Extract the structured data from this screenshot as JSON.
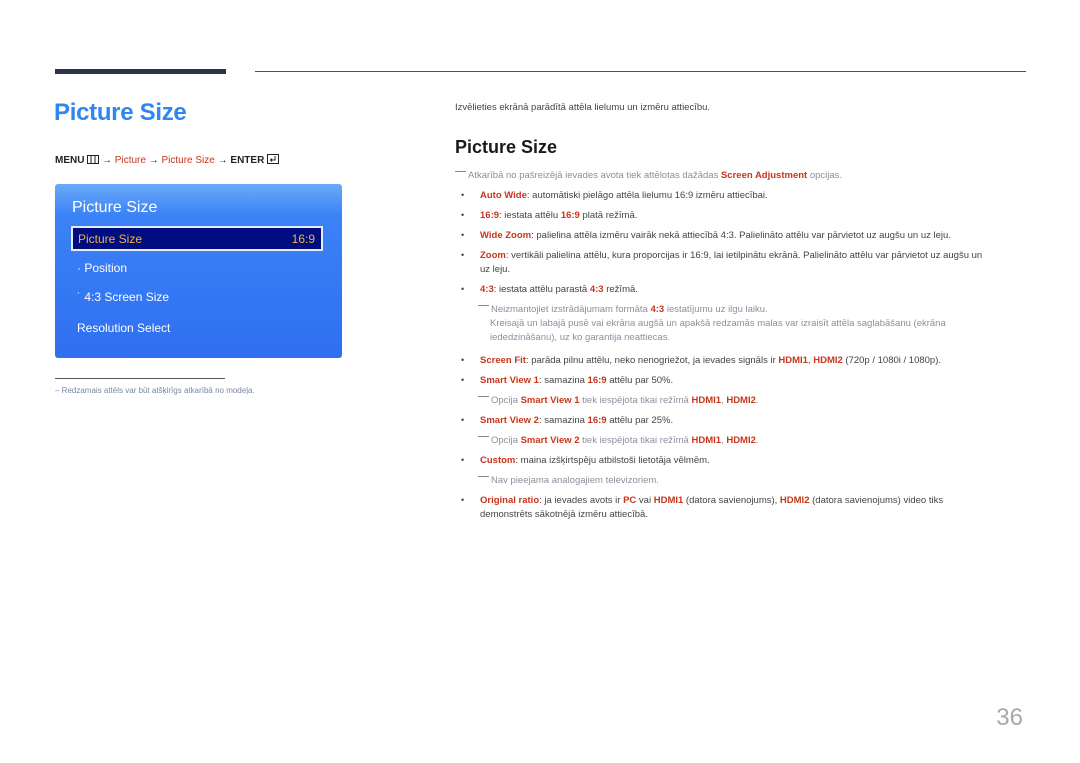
{
  "page": {
    "title": "Picture Size",
    "page_number": "36"
  },
  "menu_path": {
    "menu": "MENU",
    "sep": "→",
    "picture": "Picture",
    "picture_size": "Picture Size",
    "enter": "ENTER"
  },
  "osd": {
    "title": "Picture Size",
    "selected_label": "Picture Size",
    "selected_value": "16:9",
    "items": [
      {
        "label": "· Position"
      },
      {
        "label": "˙ 4:3 Screen Size"
      },
      {
        "label": "Resolution Select"
      }
    ]
  },
  "footnote": "Redzamais attēls var būt atšķirīgs atkarībā no modeļa.",
  "content": {
    "intro": "Izvēlieties ekrānā parādītā attēla lielumu un izmēru attiecību.",
    "section_title": "Picture Size",
    "note_top": {
      "pre": "Atkarībā no pašreizējā ievades avota tiek attēlotas dažādas ",
      "hl": "Screen Adjustment",
      "post": " opcijas."
    },
    "auto_wide": {
      "term": "Auto Wide",
      "text": ": automātiski pielāgo attēla lielumu 16:9 izmēru attiecībai."
    },
    "r169": {
      "term": "16:9",
      "text1": ": iestata attēlu ",
      "hl": "16:9",
      "text2": " platā režīmā."
    },
    "wide_zoom": {
      "term": "Wide Zoom",
      "text": ": palielina attēla izmēru vairāk nekā attiecībā 4:3. Palielināto attēlu var pārvietot uz augšu un uz leju."
    },
    "zoom": {
      "term": "Zoom",
      "text": ": vertikāli palielina attēlu, kura proporcijas ir 16:9, lai ietilpinātu ekrānā. Palielināto attēlu var pārvietot uz augšu un",
      "text_cont": "uz leju."
    },
    "r43": {
      "term": "4:3",
      "text1": ": iestata attēlu parastā ",
      "hl": "4:3",
      "text2": " režīmā."
    },
    "r43_note": {
      "pre": "Neizmantojiet izstrādājumam formāta ",
      "hl": "4:3",
      "post": " iestatījumu uz ilgu laiku.",
      "line2": "Kreisajā un labajā pusē vai ekrāna augšā un apakšā redzamās malas var izraisīt attēla saglabāšanu (ekrāna",
      "line3": "iededzināšanu), uz ko garantija neattiecas."
    },
    "screen_fit": {
      "term": "Screen Fit",
      "text1": ": parāda pilnu attēlu, neko nenogriežot, ja ievades signāls ir ",
      "hl1": "HDMI1",
      "sep": ", ",
      "hl2": "HDMI2",
      "text2": " (720p / 1080i / 1080p)."
    },
    "sv1": {
      "term": "Smart View 1",
      "text1": ": samazina ",
      "hl": "16:9",
      "text2": " attēlu par 50%."
    },
    "sv1_note": {
      "pre": "Opcija ",
      "hl": "Smart View 1",
      "mid": " tiek iespējota tikai režīmā ",
      "hl1": "HDMI1",
      "sep": ", ",
      "hl2": "HDMI2",
      "post": "."
    },
    "sv2": {
      "term": "Smart View 2",
      "text1": ": samazina ",
      "hl": "16:9",
      "text2": " attēlu par 25%."
    },
    "sv2_note": {
      "pre": "Opcija ",
      "hl": "Smart View 2",
      "mid": " tiek iespējota tikai režīmā ",
      "hl1": "HDMI1",
      "sep": ", ",
      "hl2": "HDMI2",
      "post": "."
    },
    "custom": {
      "term": "Custom",
      "text": ": maina izšķirtspēju atbilstoši lietotāja vēlmēm."
    },
    "custom_note": "Nav pieejama analogajiem televizoriem.",
    "original": {
      "term": "Original ratio",
      "text1": ": ja ievades avots ir ",
      "hl1": "PC",
      "text2": " vai ",
      "hl2": "HDMI1",
      "text3": " (datora savienojums), ",
      "hl3": "HDMI2",
      "text4": " (datora savienojums) video tiks",
      "line2": "demonstrēts sākotnējā izmēru attiecībā."
    }
  },
  "colors": {
    "title_blue": "#2f86f0",
    "highlight_red": "#c8361b",
    "osd_blue": "#2f6ff0",
    "osd_selected": "#000d80",
    "osd_selected_text": "#f0b43a"
  }
}
